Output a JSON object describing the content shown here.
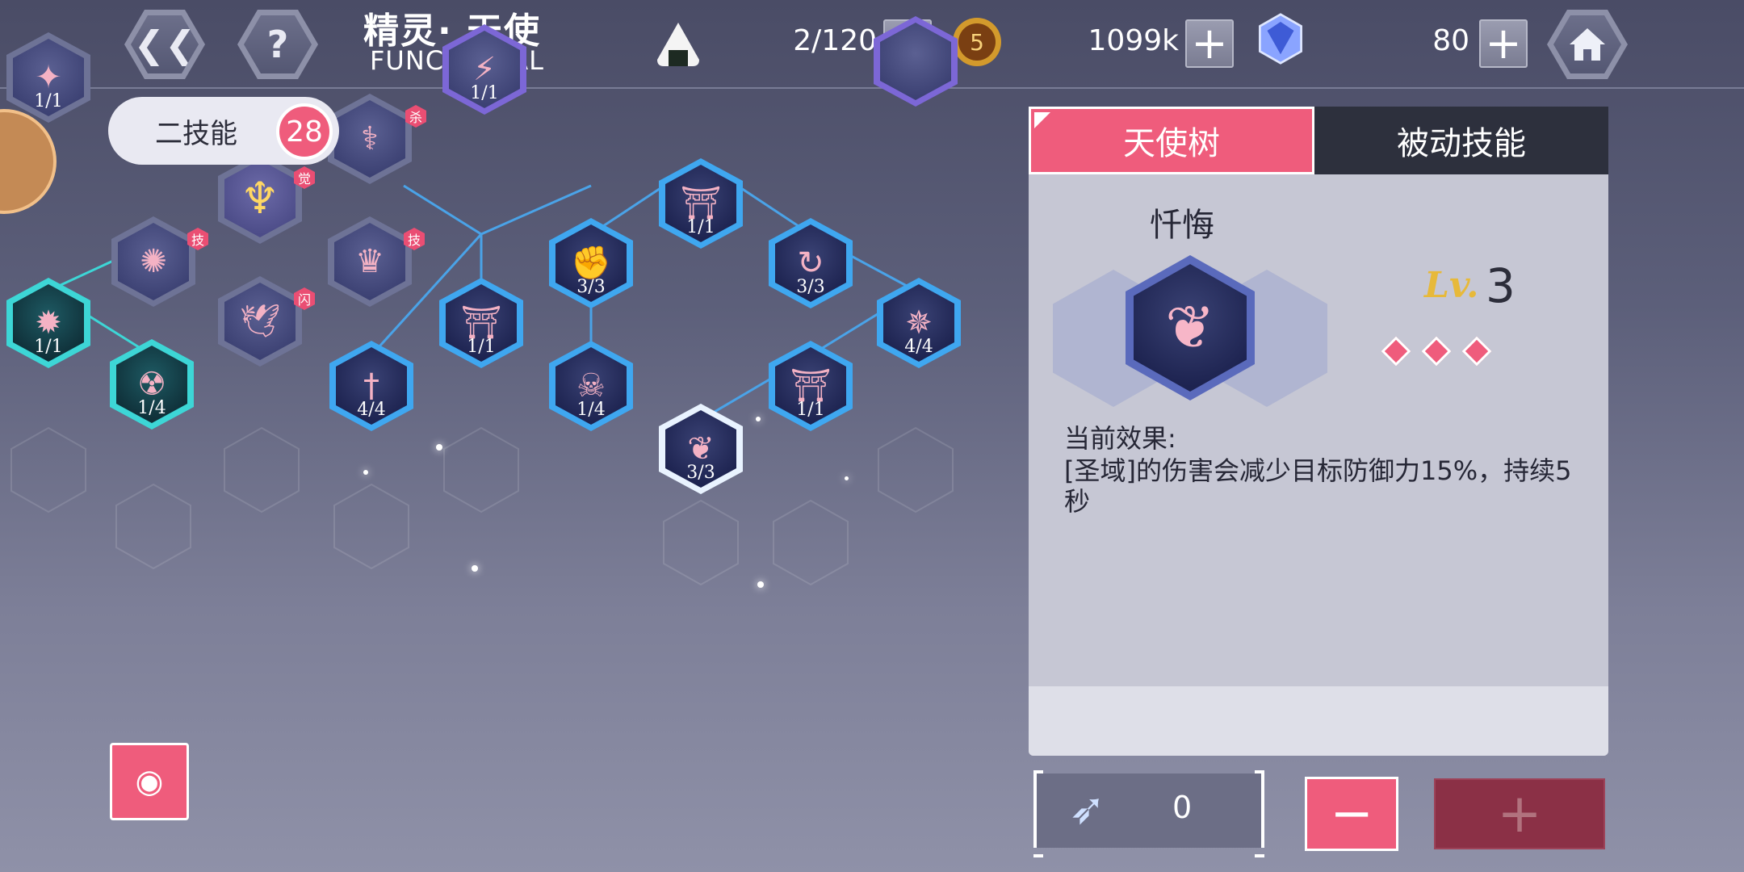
{
  "header": {
    "title_zh": "精灵· 天使",
    "title_en": "FUNCTIONAL",
    "back_icon": "chevron-left-icon",
    "help_label": "?",
    "home_icon": "home-icon"
  },
  "resources": {
    "stamina": {
      "value": "2/120",
      "icon": "rice-ball-icon"
    },
    "gold": {
      "value": "1099k",
      "icon": "gold-coin-icon"
    },
    "crystal": {
      "value": "80",
      "icon": "crystal-icon"
    },
    "plus_label": "+"
  },
  "skill_points": {
    "label": "二技能",
    "count": "28"
  },
  "tree_nodes": [
    {
      "id": "n1",
      "level": "1/1",
      "style": "blue"
    },
    {
      "id": "n2",
      "level": "3/3",
      "style": "blue"
    },
    {
      "id": "n3",
      "level": "3/3",
      "style": "blue"
    },
    {
      "id": "n4",
      "level": "1/1",
      "style": "blue"
    },
    {
      "id": "n5",
      "level": "4/4",
      "style": "blue"
    },
    {
      "id": "n6",
      "level": "4/4",
      "style": "blue"
    },
    {
      "id": "n7",
      "level": "1/4",
      "style": "blue"
    },
    {
      "id": "n8",
      "level": "1/1",
      "style": "blue"
    },
    {
      "id": "n9",
      "level": "3/3",
      "style": "selected"
    },
    {
      "id": "n10",
      "level": "1/1",
      "style": "teal"
    },
    {
      "id": "n11",
      "level": "1/4",
      "style": "teal"
    },
    {
      "id": "n12",
      "level": "1/1",
      "style": "purple"
    }
  ],
  "tags": {
    "sha": "杀",
    "jue": "觉",
    "ji": "技",
    "shan": "闪"
  },
  "tabs": {
    "active": "天使树",
    "inactive": "被动技能"
  },
  "detail": {
    "name": "忏悔",
    "lv_label": "Lv.",
    "level": "3",
    "effect_title": "当前效果:",
    "effect_text": "[圣域]的伤害会减少目标防御力15%，持续5秒"
  },
  "controls": {
    "feather_value": "0",
    "minus_label": "−",
    "plus_label": "+"
  },
  "colors": {
    "accent": "#ef5c7c",
    "node_border": "#3fa7f0",
    "dark_tab": "#2d303d"
  }
}
